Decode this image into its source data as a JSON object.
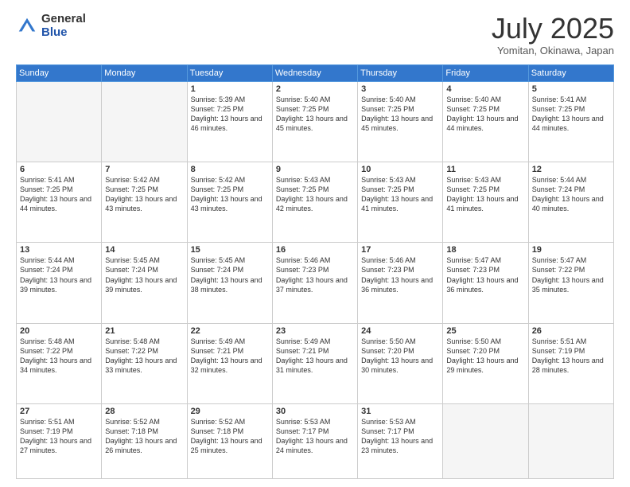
{
  "logo": {
    "general": "General",
    "blue": "Blue"
  },
  "title": "July 2025",
  "subtitle": "Yomitan, Okinawa, Japan",
  "days_of_week": [
    "Sunday",
    "Monday",
    "Tuesday",
    "Wednesday",
    "Thursday",
    "Friday",
    "Saturday"
  ],
  "weeks": [
    [
      {
        "day": "",
        "info": ""
      },
      {
        "day": "",
        "info": ""
      },
      {
        "day": "1",
        "info": "Sunrise: 5:39 AM\nSunset: 7:25 PM\nDaylight: 13 hours and 46 minutes."
      },
      {
        "day": "2",
        "info": "Sunrise: 5:40 AM\nSunset: 7:25 PM\nDaylight: 13 hours and 45 minutes."
      },
      {
        "day": "3",
        "info": "Sunrise: 5:40 AM\nSunset: 7:25 PM\nDaylight: 13 hours and 45 minutes."
      },
      {
        "day": "4",
        "info": "Sunrise: 5:40 AM\nSunset: 7:25 PM\nDaylight: 13 hours and 44 minutes."
      },
      {
        "day": "5",
        "info": "Sunrise: 5:41 AM\nSunset: 7:25 PM\nDaylight: 13 hours and 44 minutes."
      }
    ],
    [
      {
        "day": "6",
        "info": "Sunrise: 5:41 AM\nSunset: 7:25 PM\nDaylight: 13 hours and 44 minutes."
      },
      {
        "day": "7",
        "info": "Sunrise: 5:42 AM\nSunset: 7:25 PM\nDaylight: 13 hours and 43 minutes."
      },
      {
        "day": "8",
        "info": "Sunrise: 5:42 AM\nSunset: 7:25 PM\nDaylight: 13 hours and 43 minutes."
      },
      {
        "day": "9",
        "info": "Sunrise: 5:43 AM\nSunset: 7:25 PM\nDaylight: 13 hours and 42 minutes."
      },
      {
        "day": "10",
        "info": "Sunrise: 5:43 AM\nSunset: 7:25 PM\nDaylight: 13 hours and 41 minutes."
      },
      {
        "day": "11",
        "info": "Sunrise: 5:43 AM\nSunset: 7:25 PM\nDaylight: 13 hours and 41 minutes."
      },
      {
        "day": "12",
        "info": "Sunrise: 5:44 AM\nSunset: 7:24 PM\nDaylight: 13 hours and 40 minutes."
      }
    ],
    [
      {
        "day": "13",
        "info": "Sunrise: 5:44 AM\nSunset: 7:24 PM\nDaylight: 13 hours and 39 minutes."
      },
      {
        "day": "14",
        "info": "Sunrise: 5:45 AM\nSunset: 7:24 PM\nDaylight: 13 hours and 39 minutes."
      },
      {
        "day": "15",
        "info": "Sunrise: 5:45 AM\nSunset: 7:24 PM\nDaylight: 13 hours and 38 minutes."
      },
      {
        "day": "16",
        "info": "Sunrise: 5:46 AM\nSunset: 7:23 PM\nDaylight: 13 hours and 37 minutes."
      },
      {
        "day": "17",
        "info": "Sunrise: 5:46 AM\nSunset: 7:23 PM\nDaylight: 13 hours and 36 minutes."
      },
      {
        "day": "18",
        "info": "Sunrise: 5:47 AM\nSunset: 7:23 PM\nDaylight: 13 hours and 36 minutes."
      },
      {
        "day": "19",
        "info": "Sunrise: 5:47 AM\nSunset: 7:22 PM\nDaylight: 13 hours and 35 minutes."
      }
    ],
    [
      {
        "day": "20",
        "info": "Sunrise: 5:48 AM\nSunset: 7:22 PM\nDaylight: 13 hours and 34 minutes."
      },
      {
        "day": "21",
        "info": "Sunrise: 5:48 AM\nSunset: 7:22 PM\nDaylight: 13 hours and 33 minutes."
      },
      {
        "day": "22",
        "info": "Sunrise: 5:49 AM\nSunset: 7:21 PM\nDaylight: 13 hours and 32 minutes."
      },
      {
        "day": "23",
        "info": "Sunrise: 5:49 AM\nSunset: 7:21 PM\nDaylight: 13 hours and 31 minutes."
      },
      {
        "day": "24",
        "info": "Sunrise: 5:50 AM\nSunset: 7:20 PM\nDaylight: 13 hours and 30 minutes."
      },
      {
        "day": "25",
        "info": "Sunrise: 5:50 AM\nSunset: 7:20 PM\nDaylight: 13 hours and 29 minutes."
      },
      {
        "day": "26",
        "info": "Sunrise: 5:51 AM\nSunset: 7:19 PM\nDaylight: 13 hours and 28 minutes."
      }
    ],
    [
      {
        "day": "27",
        "info": "Sunrise: 5:51 AM\nSunset: 7:19 PM\nDaylight: 13 hours and 27 minutes."
      },
      {
        "day": "28",
        "info": "Sunrise: 5:52 AM\nSunset: 7:18 PM\nDaylight: 13 hours and 26 minutes."
      },
      {
        "day": "29",
        "info": "Sunrise: 5:52 AM\nSunset: 7:18 PM\nDaylight: 13 hours and 25 minutes."
      },
      {
        "day": "30",
        "info": "Sunrise: 5:53 AM\nSunset: 7:17 PM\nDaylight: 13 hours and 24 minutes."
      },
      {
        "day": "31",
        "info": "Sunrise: 5:53 AM\nSunset: 7:17 PM\nDaylight: 13 hours and 23 minutes."
      },
      {
        "day": "",
        "info": ""
      },
      {
        "day": "",
        "info": ""
      }
    ]
  ]
}
